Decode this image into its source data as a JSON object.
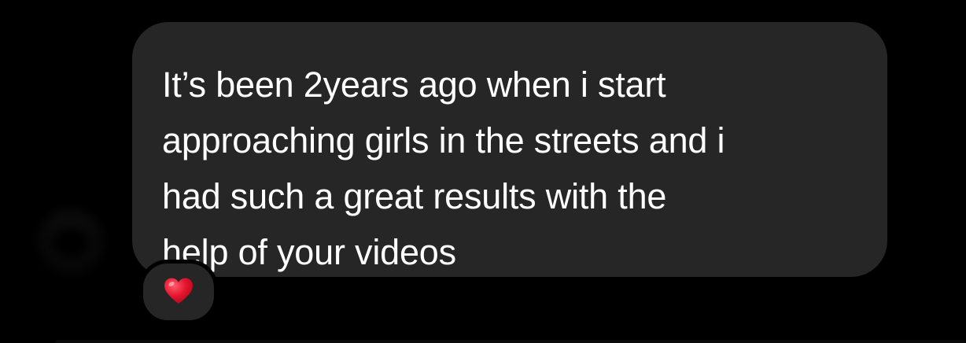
{
  "conversation": {
    "sender": {
      "avatar_icon": "blurred-avatar"
    },
    "message": {
      "text": "It’s been 2years ago when i start\napproaching girls in the streets and i\nhad such a great results with the\nhelp of your videos",
      "bubble_color": "#262626",
      "text_color": "#ffffff"
    },
    "reaction": {
      "emoji_icon": "red-heart-icon",
      "emoji": "❤️",
      "heart_color": "#e0142d"
    },
    "background_color": "#000000"
  }
}
